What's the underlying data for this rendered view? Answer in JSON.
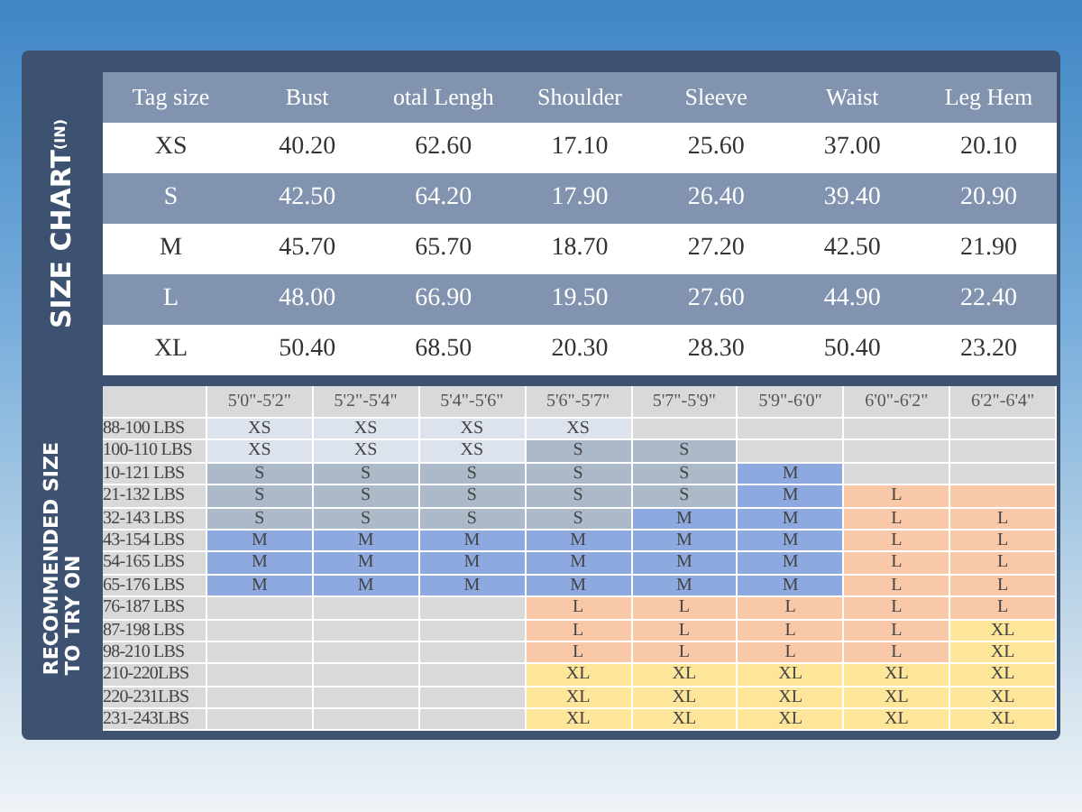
{
  "size_chart": {
    "label": "SIZE CHART",
    "unit": "(IN)",
    "columns": [
      "Tag size",
      "Bust",
      "otal Lengh",
      "Shoulder",
      "Sleeve",
      "Waist",
      "Leg Hem"
    ],
    "rows": [
      {
        "cells": [
          "XS",
          "40.20",
          "62.60",
          "17.10",
          "25.60",
          "37.00",
          "20.10"
        ]
      },
      {
        "cells": [
          "S",
          "42.50",
          "64.20",
          "17.90",
          "26.40",
          "39.40",
          "20.90"
        ]
      },
      {
        "cells": [
          "M",
          "45.70",
          "65.70",
          "18.70",
          "27.20",
          "42.50",
          "21.90"
        ]
      },
      {
        "cells": [
          "L",
          "48.00",
          "66.90",
          "19.50",
          "27.60",
          "44.90",
          "22.40"
        ]
      },
      {
        "cells": [
          "XL",
          "50.40",
          "68.50",
          "20.30",
          "28.30",
          "50.40",
          "23.20"
        ]
      }
    ]
  },
  "recommended": {
    "label_lines": [
      "RECOMMENDED SIZE",
      "TO TRY ON"
    ],
    "columns": [
      "5'0\"-5'2\"",
      "5'2\"-5'4\"",
      "5'4\"-5'6\"",
      "5'6\"-5'7\"",
      "5'7\"-5'9\"",
      "5'9\"-6'0\"",
      "6'0\"-6'2\"",
      "6'2\"-6'4\""
    ],
    "rows": [
      {
        "weight": "88-100 LBS",
        "cells": [
          {
            "text": "XS",
            "color": "#dce3ec"
          },
          {
            "text": "XS",
            "color": "#dce3ec"
          },
          {
            "text": "XS",
            "color": "#dce3ec"
          },
          {
            "text": "XS",
            "color": "#dce3ec"
          },
          {
            "color": "#d9d9d9"
          },
          {
            "color": "#d9d9d9"
          },
          {
            "color": "#d9d9d9"
          },
          {
            "color": "#d9d9d9"
          }
        ]
      },
      {
        "weight": "100-110 LBS",
        "cells": [
          {
            "text": "XS",
            "color": "#dce3ec"
          },
          {
            "text": "XS",
            "color": "#dce3ec"
          },
          {
            "text": "XS",
            "color": "#dce3ec"
          },
          {
            "text": "S",
            "color": "#acb9c9"
          },
          {
            "text": "S",
            "color": "#acb9c9"
          },
          {
            "color": "#d9d9d9"
          },
          {
            "color": "#d9d9d9"
          },
          {
            "color": "#d9d9d9"
          }
        ]
      },
      {
        "weight": "10-121 LBS",
        "cells": [
          {
            "text": "S",
            "color": "#acb9c9"
          },
          {
            "text": "S",
            "color": "#acb9c9"
          },
          {
            "text": "S",
            "color": "#acb9c9"
          },
          {
            "text": "S",
            "color": "#acb9c9"
          },
          {
            "text": "S",
            "color": "#acb9c9"
          },
          {
            "text": "M",
            "color": "#8ea9e0"
          },
          {
            "color": "#d9d9d9"
          },
          {
            "color": "#d9d9d9"
          }
        ]
      },
      {
        "weight": "21-132 LBS",
        "cells": [
          {
            "text": "S",
            "color": "#acb9c9"
          },
          {
            "text": "S",
            "color": "#acb9c9"
          },
          {
            "text": "S",
            "color": "#acb9c9"
          },
          {
            "text": "S",
            "color": "#acb9c9"
          },
          {
            "text": "S",
            "color": "#acb9c9"
          },
          {
            "text": "M",
            "color": "#8ea9e0"
          },
          {
            "text": "L",
            "color": "#f8c8a8"
          },
          {
            "color": "#f8c8a8"
          }
        ]
      },
      {
        "weight": "32-143 LBS",
        "cells": [
          {
            "text": "S",
            "color": "#acb9c9"
          },
          {
            "text": "S",
            "color": "#acb9c9"
          },
          {
            "text": "S",
            "color": "#acb9c9"
          },
          {
            "text": "S",
            "color": "#acb9c9"
          },
          {
            "text": "M",
            "color": "#8ea9e0"
          },
          {
            "text": "M",
            "color": "#8ea9e0"
          },
          {
            "text": "L",
            "color": "#f8c8a8"
          },
          {
            "text": "L",
            "color": "#f8c8a8"
          }
        ]
      },
      {
        "weight": "43-154 LBS",
        "cells": [
          {
            "text": "M",
            "color": "#8ea9e0"
          },
          {
            "text": "M",
            "color": "#8ea9e0"
          },
          {
            "text": "M",
            "color": "#8ea9e0"
          },
          {
            "text": "M",
            "color": "#8ea9e0"
          },
          {
            "text": "M",
            "color": "#8ea9e0"
          },
          {
            "text": "M",
            "color": "#8ea9e0"
          },
          {
            "text": "L",
            "color": "#f8c8a8"
          },
          {
            "text": "L",
            "color": "#f8c8a8"
          }
        ]
      },
      {
        "weight": "54-165 LBS",
        "cells": [
          {
            "text": "M",
            "color": "#8ea9e0"
          },
          {
            "text": "M",
            "color": "#8ea9e0"
          },
          {
            "text": "M",
            "color": "#8ea9e0"
          },
          {
            "text": "M",
            "color": "#8ea9e0"
          },
          {
            "text": "M",
            "color": "#8ea9e0"
          },
          {
            "text": "M",
            "color": "#8ea9e0"
          },
          {
            "text": "L",
            "color": "#f8c8a8"
          },
          {
            "text": "L",
            "color": "#f8c8a8"
          }
        ]
      },
      {
        "weight": "65-176 LBS",
        "cells": [
          {
            "text": "M",
            "color": "#8ea9e0"
          },
          {
            "text": "M",
            "color": "#8ea9e0"
          },
          {
            "text": "M",
            "color": "#8ea9e0"
          },
          {
            "text": "M",
            "color": "#8ea9e0"
          },
          {
            "text": "M",
            "color": "#8ea9e0"
          },
          {
            "text": "M",
            "color": "#8ea9e0"
          },
          {
            "text": "L",
            "color": "#f8c8a8"
          },
          {
            "text": "L",
            "color": "#f8c8a8"
          }
        ]
      },
      {
        "weight": "76-187 LBS",
        "cells": [
          {
            "color": "#d9d9d9"
          },
          {
            "color": "#d9d9d9"
          },
          {
            "color": "#d9d9d9"
          },
          {
            "text": "L",
            "color": "#f8c8a8"
          },
          {
            "text": "L",
            "color": "#f8c8a8"
          },
          {
            "text": "L",
            "color": "#f8c8a8"
          },
          {
            "text": "L",
            "color": "#f8c8a8"
          },
          {
            "text": "L",
            "color": "#f8c8a8"
          }
        ]
      },
      {
        "weight": "87-198 LBS",
        "cells": [
          {
            "color": "#d9d9d9"
          },
          {
            "color": "#d9d9d9"
          },
          {
            "color": "#d9d9d9"
          },
          {
            "text": "L",
            "color": "#f8c8a8"
          },
          {
            "text": "L",
            "color": "#f8c8a8"
          },
          {
            "text": "L",
            "color": "#f8c8a8"
          },
          {
            "text": "L",
            "color": "#f8c8a8"
          },
          {
            "text": "XL",
            "color": "#fde59a"
          }
        ]
      },
      {
        "weight": "98-210 LBS",
        "cells": [
          {
            "color": "#d9d9d9"
          },
          {
            "color": "#d9d9d9"
          },
          {
            "color": "#d9d9d9"
          },
          {
            "text": "L",
            "color": "#f8c8a8"
          },
          {
            "text": "L",
            "color": "#f8c8a8"
          },
          {
            "text": "L",
            "color": "#f8c8a8"
          },
          {
            "text": "L",
            "color": "#f8c8a8"
          },
          {
            "text": "XL",
            "color": "#fde59a"
          }
        ]
      },
      {
        "weight": "210-220LBS",
        "cells": [
          {
            "color": "#d9d9d9"
          },
          {
            "color": "#d9d9d9"
          },
          {
            "color": "#d9d9d9"
          },
          {
            "text": "XL",
            "color": "#fde59a"
          },
          {
            "text": "XL",
            "color": "#fde59a"
          },
          {
            "text": "XL",
            "color": "#fde59a"
          },
          {
            "text": "XL",
            "color": "#fde59a"
          },
          {
            "text": "XL",
            "color": "#fde59a"
          }
        ]
      },
      {
        "weight": "220-231LBS",
        "cells": [
          {
            "color": "#d9d9d9"
          },
          {
            "color": "#d9d9d9"
          },
          {
            "color": "#d9d9d9"
          },
          {
            "text": "XL",
            "color": "#fde59a"
          },
          {
            "text": "XL",
            "color": "#fde59a"
          },
          {
            "text": "XL",
            "color": "#fde59a"
          },
          {
            "text": "XL",
            "color": "#fde59a"
          },
          {
            "text": "XL",
            "color": "#fde59a"
          }
        ]
      },
      {
        "weight": "231-243LBS",
        "cells": [
          {
            "color": "#d9d9d9"
          },
          {
            "color": "#d9d9d9"
          },
          {
            "color": "#d9d9d9"
          },
          {
            "text": "XL",
            "color": "#fde59a"
          },
          {
            "text": "XL",
            "color": "#fde59a"
          },
          {
            "text": "XL",
            "color": "#fde59a"
          },
          {
            "text": "XL",
            "color": "#fde59a"
          },
          {
            "text": "XL",
            "color": "#fde59a"
          }
        ]
      }
    ]
  }
}
